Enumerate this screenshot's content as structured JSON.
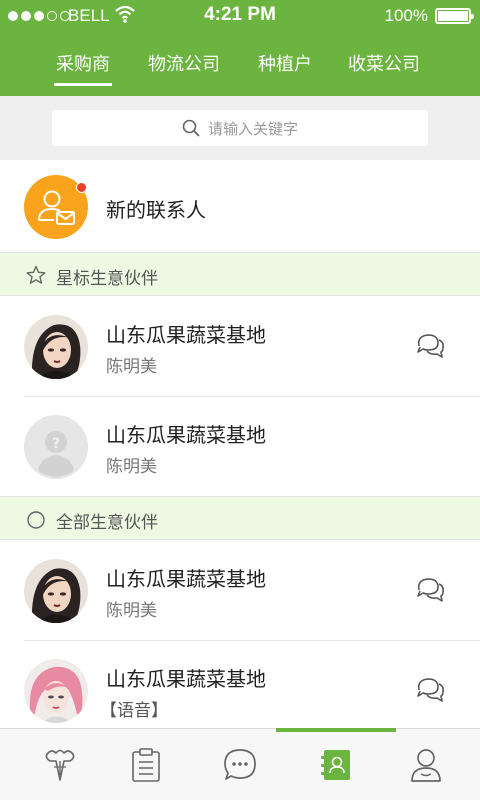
{
  "status_bar": {
    "carrier": "BELL",
    "time": "4:21 PM",
    "battery": "100%",
    "battery_level": 1.0,
    "signal_bars": 3,
    "signal_max": 5
  },
  "tabs": [
    {
      "label": "采购商",
      "active": true
    },
    {
      "label": "物流公司",
      "active": false
    },
    {
      "label": "种植户",
      "active": false
    },
    {
      "label": "收菜公司",
      "active": false
    }
  ],
  "search": {
    "placeholder": "请输入关键字"
  },
  "new_contact": {
    "label": "新的联系人",
    "icon": "contact-mail-icon",
    "has_badge": true
  },
  "sections": {
    "starred": {
      "label": "星标生意伙伴",
      "icon": "star-outline-icon"
    },
    "all": {
      "label": "全部生意伙伴",
      "icon": "circle-outline-icon"
    }
  },
  "contacts": [
    {
      "name": "山东瓜果蔬菜基地",
      "subtitle": "陈明美",
      "avatar": "portrait-dark-hair",
      "chat": true
    },
    {
      "name": "山东瓜果蔬菜基地",
      "subtitle": "陈明美",
      "avatar": "default-placeholder-avatar",
      "chat": false
    },
    {
      "name": "山东瓜果蔬菜基地",
      "subtitle": "陈明美",
      "avatar": "portrait-dark-hair",
      "chat": true
    },
    {
      "name": "山东瓜果蔬菜基地",
      "subtitle": "【语音】",
      "avatar": "portrait-pink-hair",
      "chat": true
    }
  ],
  "bottom_nav": [
    {
      "icon": "vegetable-icon",
      "active": false
    },
    {
      "icon": "clipboard-icon",
      "active": false
    },
    {
      "icon": "chat-bubble-icon",
      "active": false
    },
    {
      "icon": "contacts-book-icon",
      "active": true
    },
    {
      "icon": "profile-icon",
      "active": false
    }
  ],
  "colors": {
    "brand_green": "#6bb43f",
    "section_bg": "#eef9e4",
    "avatar_orange": "#f9a41c",
    "badge_red": "#e8402b"
  }
}
